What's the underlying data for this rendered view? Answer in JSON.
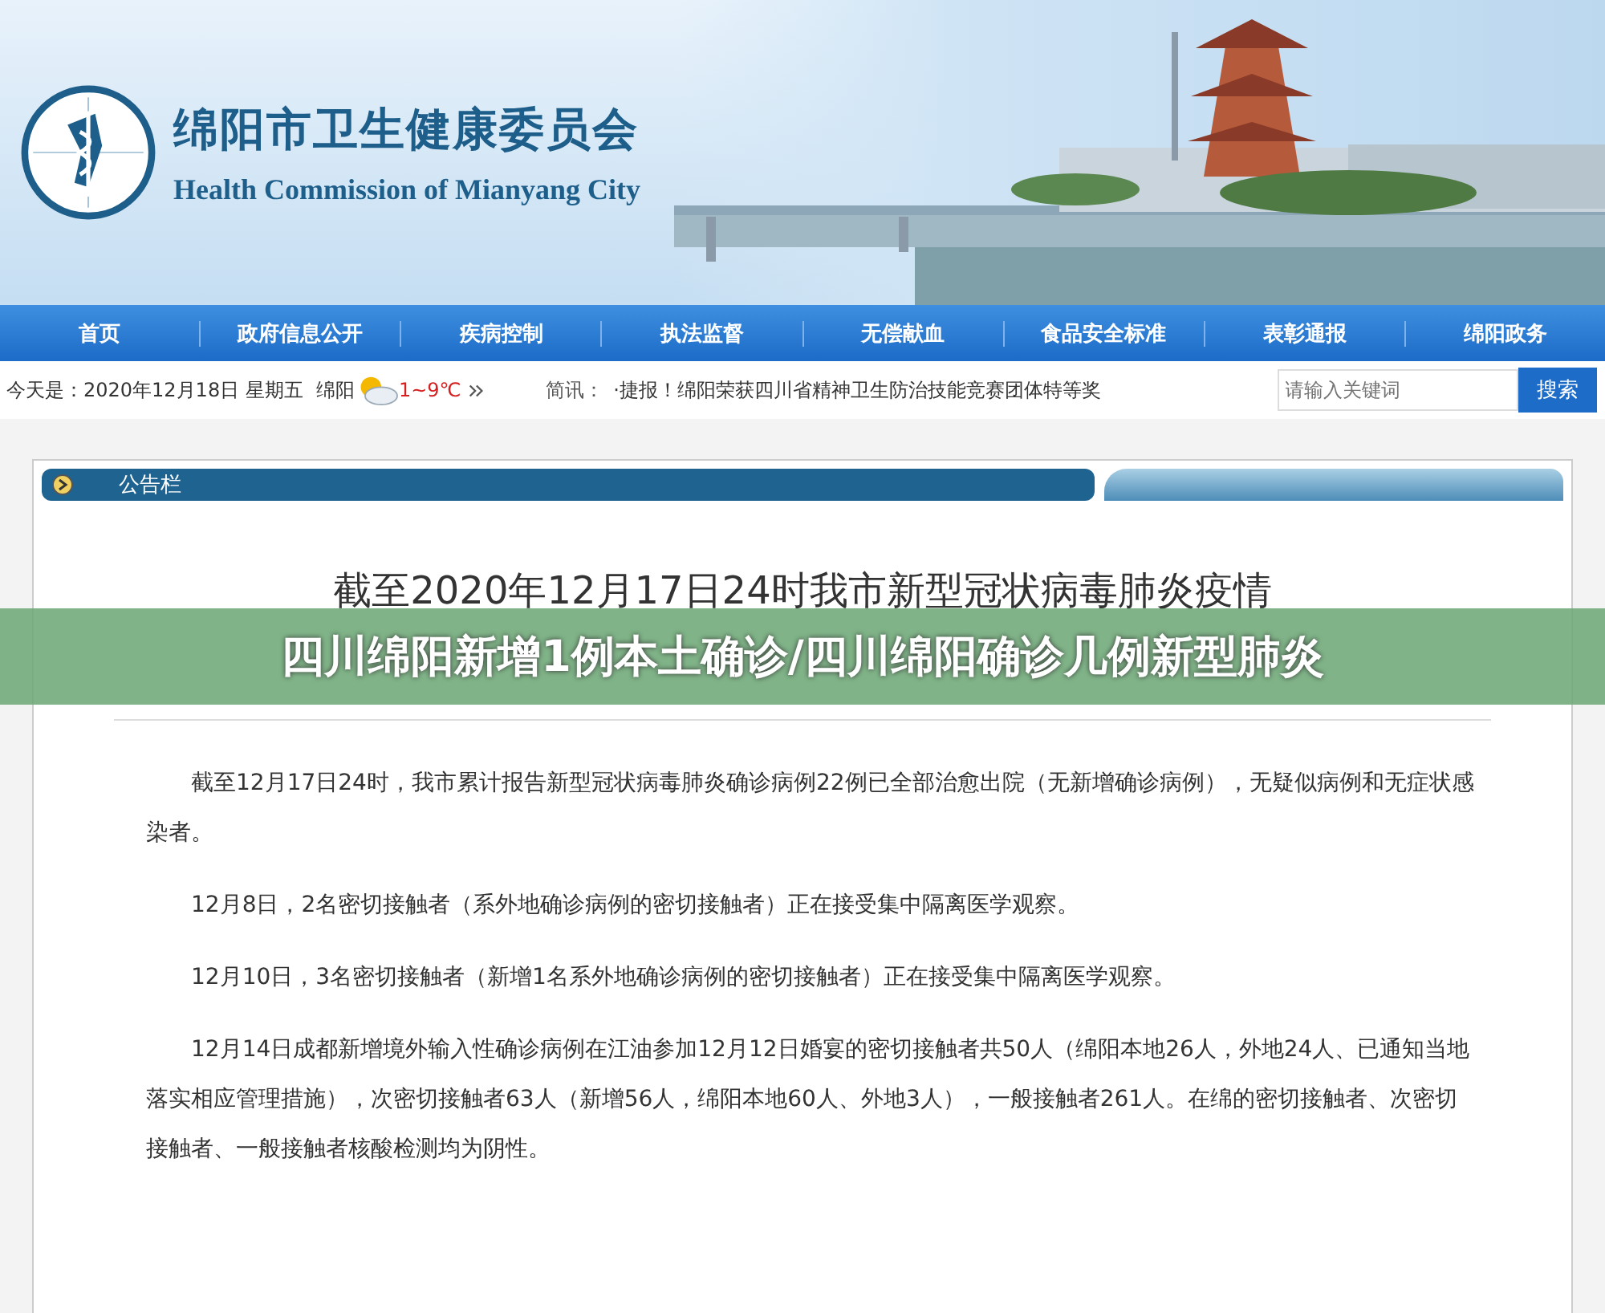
{
  "header": {
    "title": "绵阳市卫生健康委员会",
    "subtitle": "Health Commission of Mianyang City"
  },
  "nav": [
    {
      "label": "首页"
    },
    {
      "label": "政府信息公开"
    },
    {
      "label": "疾病控制"
    },
    {
      "label": "执法监督"
    },
    {
      "label": "无偿献血"
    },
    {
      "label": "食品安全标准"
    },
    {
      "label": "表彰通报"
    },
    {
      "label": "绵阳政务"
    }
  ],
  "info_bar": {
    "date": "今天是：2020年12月18日  星期五",
    "city": "绵阳",
    "temperature": "1~9℃",
    "news_label": "简讯：",
    "news_item": "·捷报！绵阳荣获四川省精神卫生防治技能竞赛团体特等奖",
    "search": {
      "placeholder": "请输入关键词"
    },
    "search_button": "搜索"
  },
  "panel": {
    "title": "公告栏",
    "article_title": "截至2020年12月17日24时我市新型冠状病毒肺炎疫情",
    "paragraphs": [
      "截至12月17日24时，我市累计报告新型冠状病毒肺炎确诊病例22例已全部治愈出院（无新增确诊病例），无疑似病例和无症状感染者。",
      "12月8日，2名密切接触者（系外地确诊病例的密切接触者）正在接受集中隔离医学观察。",
      "12月10日，3名密切接触者（新增1名系外地确诊病例的密切接触者）正在接受集中隔离医学观察。",
      "12月14日成都新增境外输入性确诊病例在江油参加12月12日婚宴的密切接触者共50人（绵阳本地26人，外地24人、已通知当地落实相应管理措施），次密切接触者63人（新增56人，绵阳本地60人、外地3人），一般接触者261人。在绵的密切接触者、次密切接触者、一般接触者核酸检测均为阴性。"
    ]
  },
  "overlay_banner": "四川绵阳新增1例本土确诊/四川绵阳确诊几例新型肺炎"
}
